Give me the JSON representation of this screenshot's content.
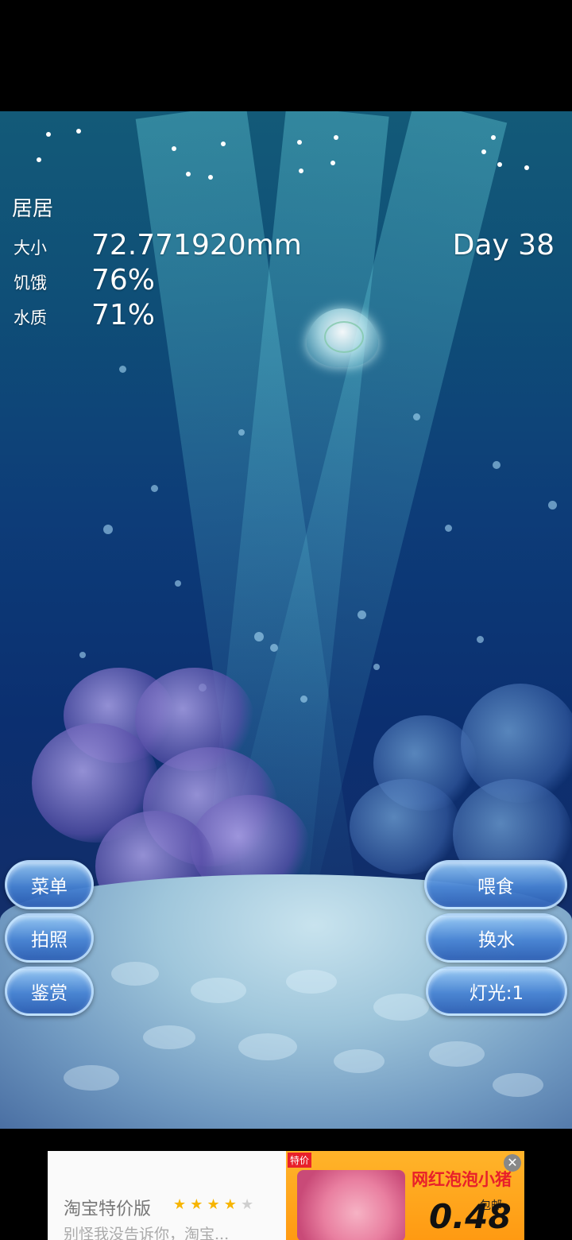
{
  "pet": {
    "name": "居居",
    "size_label": "大小",
    "size_value": "72.771920mm",
    "hunger_label": "饥饿",
    "hunger_value": "76%",
    "water_label": "水质",
    "water_value": "71%",
    "day": "Day 38"
  },
  "buttons": {
    "menu": "菜单",
    "photo": "拍照",
    "appreciate": "鉴赏",
    "feed": "喂食",
    "change_water": "换水",
    "light": "灯光:1"
  },
  "ad": {
    "brand_title": "淘宝特价版",
    "description": "别怪我没告诉你，淘宝...",
    "rating_stars": 4,
    "badge": "特价",
    "product_title": "网红泡泡小猪",
    "shipping": "包邮",
    "price": "0.48"
  },
  "colors": {
    "button_fill": "#4f8fd8",
    "ad_orange": "#ff9a12",
    "ad_red_text": "#e8202a"
  }
}
